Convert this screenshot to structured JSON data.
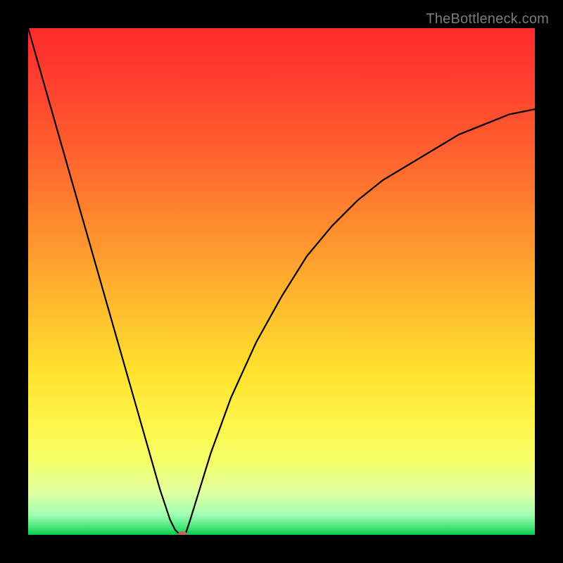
{
  "watermark": {
    "text": "TheBottleneck.com"
  },
  "chart_data": {
    "type": "line",
    "title": "",
    "xlabel": "",
    "ylabel": "",
    "xlim": [
      0,
      100
    ],
    "ylim": [
      0,
      100
    ],
    "grid": false,
    "legend": false,
    "series": [
      {
        "name": "curve",
        "color": "#000000",
        "x": [
          0,
          4,
          8,
          12,
          16,
          20,
          24,
          26,
          28,
          29,
          30,
          31,
          32,
          36,
          40,
          45,
          50,
          55,
          60,
          65,
          70,
          75,
          80,
          85,
          90,
          95,
          100
        ],
        "y": [
          100,
          86,
          72,
          58,
          44,
          30,
          16,
          9,
          3,
          1,
          0,
          0,
          3,
          16,
          27,
          38,
          47,
          55,
          61,
          66,
          70,
          73,
          76,
          79,
          81,
          83,
          84
        ]
      }
    ],
    "markers": [
      {
        "name": "min-point",
        "x": 30.5,
        "y": 0,
        "color": "#c9635d",
        "rx": 7,
        "ry": 5
      }
    ],
    "background_gradient_stops": [
      {
        "pos": 0,
        "color": "#ff2b2b"
      },
      {
        "pos": 10,
        "color": "#ff3e2f"
      },
      {
        "pos": 22,
        "color": "#ff5a2e"
      },
      {
        "pos": 34,
        "color": "#ff7d2e"
      },
      {
        "pos": 46,
        "color": "#ffa02e"
      },
      {
        "pos": 57,
        "color": "#ffc22e"
      },
      {
        "pos": 68,
        "color": "#ffe22e"
      },
      {
        "pos": 78,
        "color": "#fff44a"
      },
      {
        "pos": 85,
        "color": "#f6ff66"
      },
      {
        "pos": 92,
        "color": "#dcffa0"
      },
      {
        "pos": 96,
        "color": "#a0ffb4"
      },
      {
        "pos": 99,
        "color": "#35e06a"
      },
      {
        "pos": 100,
        "color": "#00c853"
      }
    ]
  }
}
